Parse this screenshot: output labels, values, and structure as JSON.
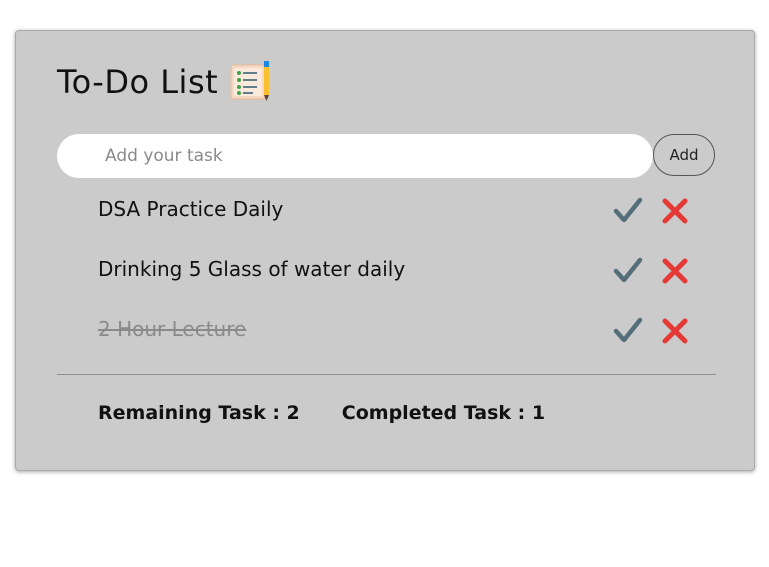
{
  "header": {
    "title": "To-Do List",
    "icon": "checklist-icon"
  },
  "add_task": {
    "placeholder": "Add your task",
    "value": "",
    "button_label": "Add"
  },
  "tasks": [
    {
      "text": "DSA Practice Daily",
      "completed": false
    },
    {
      "text": "Drinking 5 Glass of water daily",
      "completed": false
    },
    {
      "text": "2 Hour Lecture",
      "completed": true
    }
  ],
  "actions": {
    "complete_icon": "check-mark-icon",
    "delete_icon": "cross-mark-icon"
  },
  "stats": {
    "remaining_label": "Remaining Task",
    "remaining_count": "2",
    "completed_label": "Completed Task",
    "completed_count": "1",
    "separator": " : "
  },
  "colors": {
    "card_background": "#cbcbcb",
    "check": "#546e7a",
    "delete": "#e53935"
  }
}
